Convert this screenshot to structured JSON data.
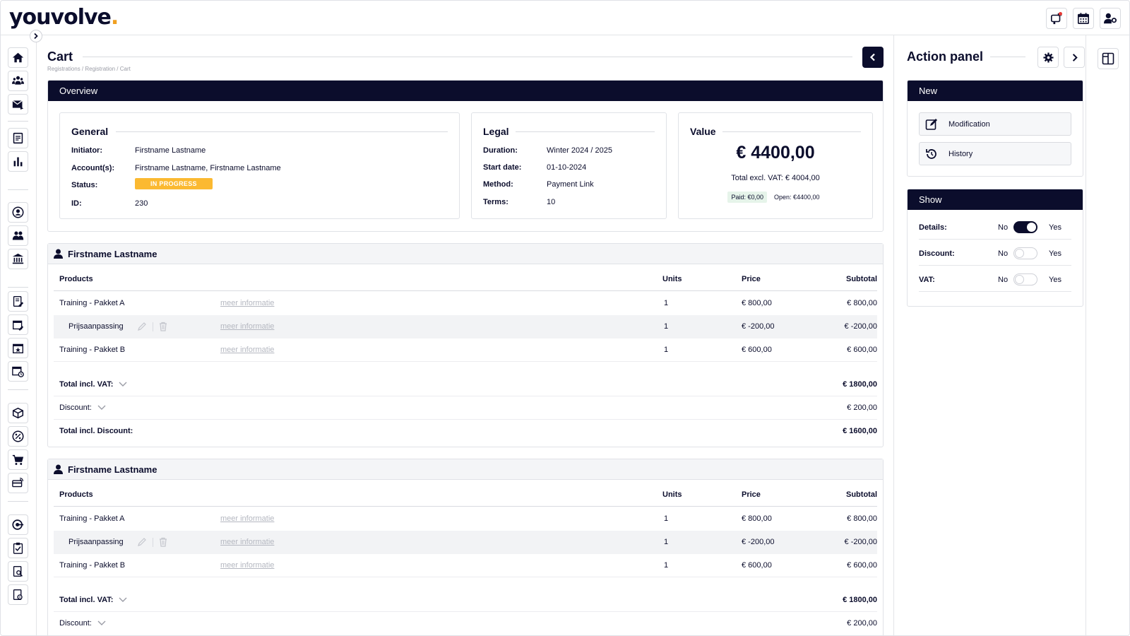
{
  "app": {
    "logo_text": "youvolve",
    "logo_dot": "."
  },
  "page": {
    "title": "Cart",
    "breadcrumb": "Registrations / Registration / Cart"
  },
  "overview": {
    "header": "Overview",
    "general": {
      "title": "General",
      "rows": [
        {
          "key": "Initiator:",
          "value": "Firstname Lastname"
        },
        {
          "key": "Account(s):",
          "value": "Firstname Lastname, Firstname Lastname"
        },
        {
          "key": "Status:",
          "value": "IN PROGRESS"
        },
        {
          "key": "ID:",
          "value": "230"
        }
      ]
    },
    "legal": {
      "title": "Legal",
      "rows": [
        {
          "key": "Duration:",
          "value": "Winter 2024 / 2025"
        },
        {
          "key": "Start date:",
          "value": "01-10-2024"
        },
        {
          "key": "Method:",
          "value": "Payment Link"
        },
        {
          "key": "Terms:",
          "value": "10"
        }
      ]
    },
    "value": {
      "title": "Value",
      "amount": "€ 4400,00",
      "excl_vat": "Total excl. VAT: € 4004,00",
      "paid": "Paid: €0,00",
      "open": "Open: €4400,00"
    }
  },
  "carts": [
    {
      "name": "Firstname Lastname",
      "headers": {
        "products": "Products",
        "units": "Units",
        "price": "Price",
        "subtotal": "Subtotal"
      },
      "rows": [
        {
          "product": "Training - Pakket A",
          "link": "meer informatie",
          "units": "1",
          "price": "€ 800,00",
          "subtotal": "€ 800,00"
        },
        {
          "product": "Prijsaanpassing",
          "link": "meer informatie",
          "units": "1",
          "price": "€ -200,00",
          "subtotal": "€ -200,00"
        },
        {
          "product": "Training - Pakket B",
          "link": "meer informatie",
          "units": "1",
          "price": "€ 600,00",
          "subtotal": "€ 600,00"
        }
      ],
      "totals": [
        {
          "label": "Total incl. VAT:",
          "value": "€ 1800,00"
        },
        {
          "label": "Discount:",
          "value": "€ 200,00"
        },
        {
          "label": "Total incl. Discount:",
          "value": "€ 1600,00"
        }
      ]
    },
    {
      "name": "Firstname Lastname",
      "headers": {
        "products": "Products",
        "units": "Units",
        "price": "Price",
        "subtotal": "Subtotal"
      },
      "rows": [
        {
          "product": "Training - Pakket A",
          "link": "meer informatie",
          "units": "1",
          "price": "€ 800,00",
          "subtotal": "€ 800,00"
        },
        {
          "product": "Prijsaanpassing",
          "link": "meer informatie",
          "units": "1",
          "price": "€ -200,00",
          "subtotal": "€ -200,00"
        },
        {
          "product": "Training - Pakket B",
          "link": "meer informatie",
          "units": "1",
          "price": "€ 600,00",
          "subtotal": "€ 600,00"
        }
      ],
      "totals": [
        {
          "label": "Total incl. VAT:",
          "value": "€ 1800,00"
        },
        {
          "label": "Discount:",
          "value": "€ 200,00"
        }
      ]
    }
  ],
  "action_panel": {
    "title": "Action panel",
    "new": {
      "header": "New",
      "actions": [
        {
          "label": "Modification",
          "icon": "edit-icon"
        },
        {
          "label": "History",
          "icon": "history-icon"
        }
      ]
    },
    "show": {
      "header": "Show",
      "rows": [
        {
          "label": "Details:",
          "no": "No",
          "yes": "Yes",
          "on": true
        },
        {
          "label": "Discount:",
          "no": "No",
          "yes": "Yes",
          "on": false
        },
        {
          "label": "VAT:",
          "no": "No",
          "yes": "Yes",
          "on": false
        }
      ]
    }
  },
  "colors": {
    "navy": "#0b0d2c",
    "status_in_progress": "#fbb931",
    "paid_bg": "#e6f4ea",
    "logo_accent": "#f0a020"
  }
}
